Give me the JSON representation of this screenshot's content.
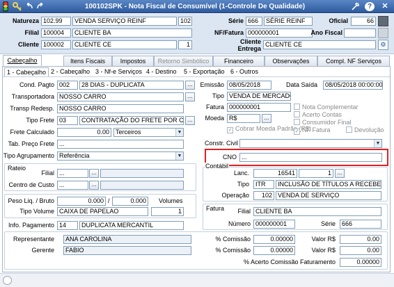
{
  "window": {
    "title": "100102SPK - Nota Fiscal de Consumível (1-Controle De Qualidade)",
    "colors": {
      "titlebar_top": "#4b77b8",
      "titlebar_bottom": "#2a569a",
      "header_bg": "#dce6f2",
      "highlight": "#e02020"
    }
  },
  "toolbar": {
    "icons": [
      "traffic-light-icon",
      "key-icon",
      "back-arrow-icon",
      "forward-arrow-icon",
      "tools-icon",
      "help-icon",
      "close-icon"
    ],
    "help_label": "?",
    "close_label": "✕"
  },
  "header": {
    "natureza_label": "Natureza",
    "natureza_code": "102.99",
    "natureza_desc": "VENDA SERVIÇO REINF",
    "natureza_num": "102",
    "filial_label": "Filial",
    "filial_code": "100004",
    "filial_desc": "CLIENTE BA",
    "cliente_label": "Cliente",
    "cliente_code": "100002",
    "cliente_desc": "CLIENTE CE",
    "cliente_num": "1",
    "serie_label": "Série",
    "serie_code": "666",
    "serie_desc": "SÉRIE REINF",
    "oficial_label": "Oficial",
    "oficial_value": "66",
    "nf_fatura_label": "NF/Fatura",
    "nf_fatura_value": "000000001",
    "ano_fiscal_label": "Ano Fiscal",
    "cliente_entrega_label": "Cliente\nEntrega",
    "cliente_entrega_line1": "Cliente",
    "cliente_entrega_line2": "Entrega",
    "cliente_entrega_value": "CLIENTE CE"
  },
  "tabs": [
    "Cabeçalho",
    "Itens Fiscais",
    "Impostos",
    "Retorno Simbólico",
    "Financeiro",
    "Observações",
    "Compl. NF Serviços"
  ],
  "subtabs": [
    "1 - Cabeçalho",
    "2 - Cabeçalho",
    "3 - Nf-e Serviços",
    "4 - Destino",
    "5 - Exportação",
    "6 - Outros"
  ],
  "left": {
    "cond_pagto_label": "Cond. Pagto",
    "cond_pagto_code": "002",
    "cond_pagto_desc": "28 DIAS - DUPLICATA",
    "transportadora_label": "Transportadora",
    "transportadora_value": "NOSSO CARRO",
    "transp_redesp_label": "Transp Redesp.",
    "transp_redesp_value": "NOSSO CARRO",
    "tipo_frete_label": "Tipo Frete",
    "tipo_frete_code": "03",
    "tipo_frete_desc": "CONTRATAÇÃO DO FRETE POR CONTA",
    "frete_calc_label": "Frete Calculado",
    "frete_calc_value": "0.00",
    "frete_calc_option": "Terceiros",
    "tab_preco_label": "Tab. Preço Frete",
    "tab_preco_value": "...",
    "tipo_agrup_label": "Tipo Agrupamento",
    "tipo_agrup_value": "Referência",
    "rateio_label": "Rateio",
    "filial_label": "Filial",
    "filial_value": "...",
    "centro_label": "Centro de Custo",
    "centro_value": "...",
    "peso_label": "Peso Liq. / Bruto",
    "peso_liq": "0.000",
    "peso_sep": "/",
    "peso_bruto": "0.000",
    "volumes_label": "Volumes",
    "tipo_volume_label": "Tipo Volume",
    "tipo_volume_value": "CAIXA DE PAPELAO",
    "volumes_value": "1",
    "info_pagto_label": "Info. Pagamento",
    "info_pagto_code": "14",
    "info_pagto_desc": "DUPLICATA MERCANTIL"
  },
  "right": {
    "emissao_label": "Emissão",
    "emissao_value": "08/05/2018",
    "data_saida_label": "Data Saída",
    "data_saida_value": "08/05/2018 00:00:00",
    "tipo_label": "Tipo",
    "tipo_value": "VENDA DE MERCADORI",
    "fatura_label": "Fatura",
    "fatura_value": "000000001",
    "moeda_label": "Moeda",
    "moeda_value": "R$",
    "cobrar_moeda_label": "Cobrar Moeda Padrão (R$)",
    "checks": [
      "Nota Complementar",
      "Acerto Contas",
      "Consumidor Final",
      "NF Fatura",
      "Devolução"
    ],
    "constr_civil_label": "Constr. Civil",
    "cno_label": "CNO",
    "cno_value": "...",
    "contabil_label": "Contábil",
    "lanc_label": "Lanc.",
    "lanc_value": "16541",
    "lanc_seq": "1",
    "tipo2_label": "Tipo",
    "tipo2_code": "ITR",
    "tipo2_desc": "INCLUSÃO DE TÍTULOS A RECEBER",
    "operacao_label": "Operação",
    "operacao_code": "102",
    "operacao_desc": "VENDA DE SERVIÇO",
    "fatura_group_label": "Fatura",
    "fat_filial_label": "Filial",
    "fat_filial_value": "CLIENTE BA",
    "numero_label": "Número",
    "numero_value": "000000001",
    "serie_label": "Série",
    "serie_value": "666"
  },
  "bottom": {
    "representante_label": "Representante",
    "representante_value": "ANA CAROLINA",
    "gerente_label": "Gerente",
    "gerente_value": "FABIO",
    "pct_comissao_label": "% Comissão",
    "pct_comissao_1": "0.00000",
    "pct_comissao_2": "0.00000",
    "valor_label": "Valor R$",
    "valor_1": "0.00",
    "valor_2": "0.00",
    "acerto_label": "% Acerto Comissão Faturamento",
    "acerto_value": "0.00000"
  },
  "button_dots": "..."
}
